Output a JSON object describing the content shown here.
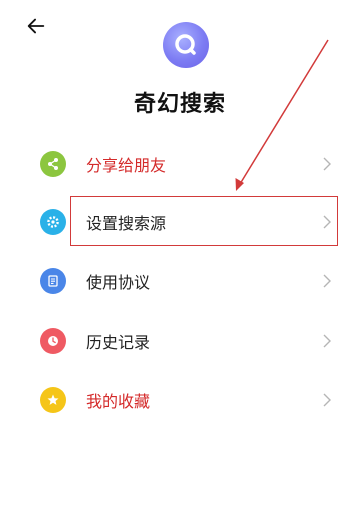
{
  "header": {
    "back_icon": "arrow-left-icon",
    "app_title": "奇幻搜索",
    "logo_icon": "search-icon"
  },
  "menu": {
    "items": [
      {
        "label": "分享给朋友",
        "icon": "share-icon",
        "icon_color": "#8cc63f",
        "text_color": "#d42a2a"
      },
      {
        "label": "设置搜索源",
        "icon": "gear-icon",
        "icon_color": "#2ab1e8",
        "text_color": "#222222"
      },
      {
        "label": "使用协议",
        "icon": "document-icon",
        "icon_color": "#4a86e8",
        "text_color": "#222222"
      },
      {
        "label": "历史记录",
        "icon": "clock-icon",
        "icon_color": "#ef5a63",
        "text_color": "#222222"
      },
      {
        "label": "我的收藏",
        "icon": "star-icon",
        "icon_color": "#f5c518",
        "text_color": "#d42a2a"
      }
    ]
  },
  "annotation": {
    "color": "#d23a3a",
    "target": "设置搜索源"
  }
}
